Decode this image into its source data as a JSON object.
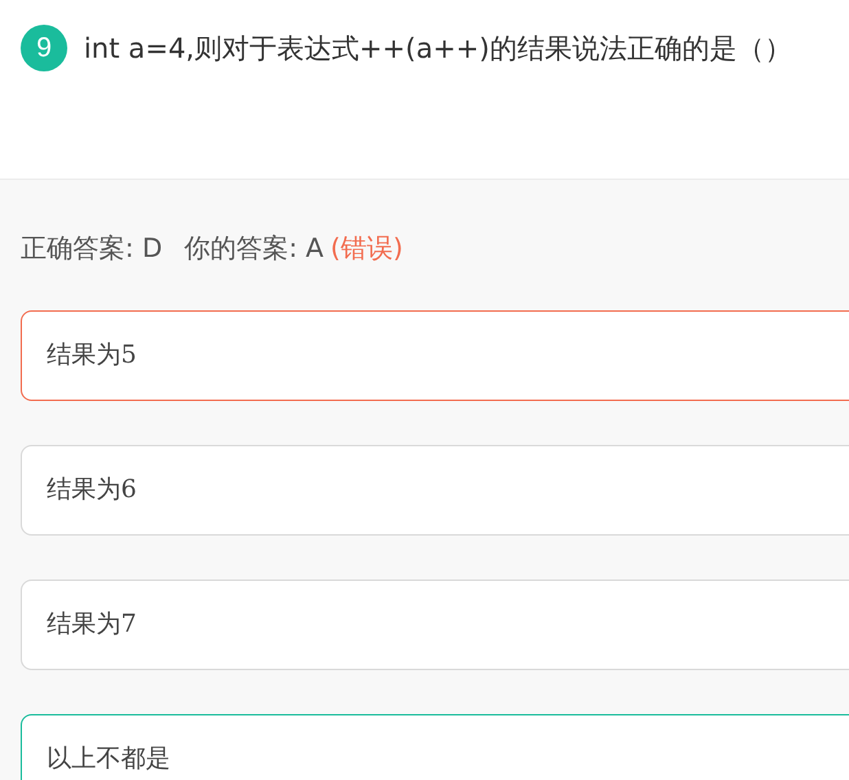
{
  "question": {
    "number": "9",
    "text": "int a=4,则对于表达式++(a++)的结果说法正确的是（）"
  },
  "result": {
    "correct_label": "正确答案: D",
    "your_label": "你的答案: A",
    "verdict": "(错误)"
  },
  "options": [
    {
      "text": "结果为5",
      "kind": "wrong"
    },
    {
      "text": "结果为6",
      "kind": "normal"
    },
    {
      "text": "结果为7",
      "kind": "normal"
    },
    {
      "text": "以上不都是",
      "kind": "correct"
    }
  ]
}
